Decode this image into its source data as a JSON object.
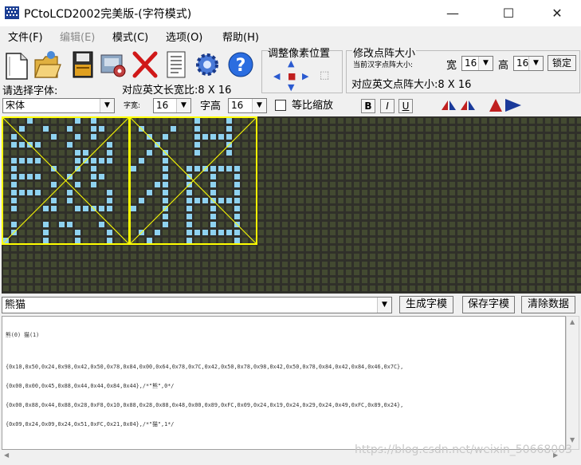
{
  "window": {
    "title": "PCtoLCD2002完美版-(字符模式)",
    "minimize": "—",
    "maximize": "☐",
    "close": "✕"
  },
  "menu": [
    "文件(F)",
    "编辑(E)",
    "模式(C)",
    "选项(O)",
    "帮助(H)"
  ],
  "toolbar": {
    "icons": [
      "new-file-icon",
      "open-folder-icon",
      "save-disk-icon",
      "gears-machine-icon",
      "delete-x-icon",
      "document-icon",
      "settings-gear-icon",
      "help-question-icon"
    ],
    "select_font_label": "请选择字体:",
    "english_ratio_label": "对应英文长宽比:8 X 16",
    "font_name": "宋体",
    "char_width_label": "字宽:",
    "char_width": "16",
    "char_height_label": "字高",
    "char_height": "16",
    "proportional_label": "等比缩放",
    "bold": "B",
    "italic": "I",
    "underline": "U",
    "adjust_pixel_title": "调整像素位置",
    "matrix_title": "修改点阵大小",
    "matrix_current_label": "当前汉字点阵大小:",
    "matrix_width_label": "宽",
    "matrix_width": "16",
    "matrix_height_label": "高",
    "matrix_height": "16",
    "lock_button": "锁定",
    "english_matrix_label": "对应英文点阵大小:8 X 16"
  },
  "lcd": {
    "bg_color": "#30302a",
    "on_color": "#8fd2f0",
    "off_color": "#434a31",
    "frame_color": "#ffff00",
    "glyphs": [
      "熊",
      "猫"
    ]
  },
  "input": {
    "text": "熊猫",
    "generate_button": "生成字模",
    "save_button": "保存字模",
    "clear_button": "清除数据"
  },
  "output": {
    "lines": [
      "熊(0) 猫(1)",
      "",
      "{0x10,0x50,0x24,0x98,0x42,0x50,0x78,0x84,0x00,0x64,0x78,0x7C,0x42,0x50,0x78,0x98,0x42,0x50,0x78,0x84,0x42,0x84,0x46,0x7C},",
      "{0x00,0x00,0x45,0x88,0x44,0x44,0x84,0x44},/*\"熊\",0*/",
      "{0x00,0x88,0x44,0x88,0x28,0xF8,0x10,0x88,0x28,0x88,0x48,0x00,0x89,0xFC,0x09,0x24,0x19,0x24,0x29,0x24,0x49,0xFC,0x89,0x24},",
      "{0x09,0x24,0x09,0x24,0x51,0xFC,0x21,0x04},/*\"猫\",1*/"
    ]
  },
  "watermark": "https://blog.csdn.net/weixin_50668003"
}
